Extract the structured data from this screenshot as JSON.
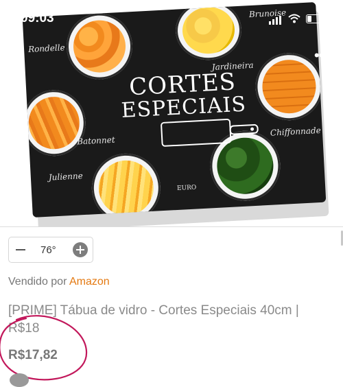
{
  "status_bar": {
    "time": "09:03",
    "battery_level": 0.3
  },
  "product_image": {
    "title_line1": "CORTES",
    "title_line2": "ESPECIAIS",
    "labels": [
      "Rondelle",
      "Brunoise",
      "Jardineira",
      "Batonnet",
      "Chiffonnade",
      "Julienne"
    ],
    "brand_mark": "EURO"
  },
  "quantity": {
    "value": "76°"
  },
  "seller": {
    "prefix": "Vendido por",
    "name": "Amazon"
  },
  "product": {
    "title": "[PRIME] Tábua de vidro - Cortes Especiais 40cm | R$18",
    "price": "R$17,82"
  },
  "colors": {
    "seller_accent": "#e47911",
    "annotation_circle": "#c2185b"
  }
}
